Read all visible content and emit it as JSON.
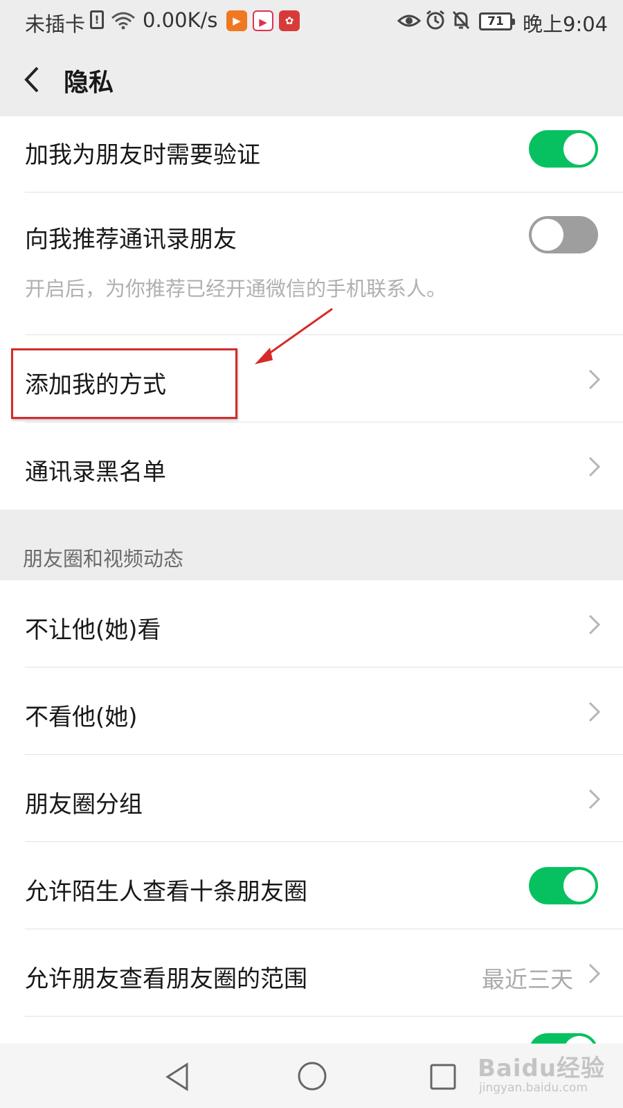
{
  "status_bar": {
    "carrier": "未插卡",
    "speed": "0.00K/s",
    "battery": "71",
    "time": "晚上9:04",
    "app_icons": [
      "video-app-icon",
      "tv-app-icon",
      "huawei-app-icon"
    ]
  },
  "header": {
    "title": "隐私"
  },
  "group1": {
    "friend_verify": {
      "label": "加我为朋友时需要验证",
      "toggle_on": true
    },
    "recommend_contacts": {
      "label": "向我推荐通讯录朋友",
      "desc": "开启后，为你推荐已经开通微信的手机联系人。",
      "toggle_on": false
    },
    "add_methods": {
      "label": "添加我的方式"
    },
    "blacklist": {
      "label": "通讯录黑名单"
    }
  },
  "section_moments": {
    "title": "朋友圈和视频动态"
  },
  "group2": {
    "dont_let_see": {
      "label": "不让他(她)看"
    },
    "dont_see": {
      "label": "不看他(她)"
    },
    "moments_groups": {
      "label": "朋友圈分组"
    },
    "stranger_ten": {
      "label": "允许陌生人查看十条朋友圈",
      "toggle_on": true
    },
    "moments_range": {
      "label": "允许朋友查看朋友圈的范围",
      "value": "最近三天"
    }
  },
  "watermark": {
    "brand": "Baidu经验",
    "url": "jingyan.baidu.com"
  },
  "colors": {
    "toggle_on": "#07c160",
    "toggle_off": "#9e9e9e",
    "annotation_red": "#d62a2a",
    "background": "#ededed"
  }
}
